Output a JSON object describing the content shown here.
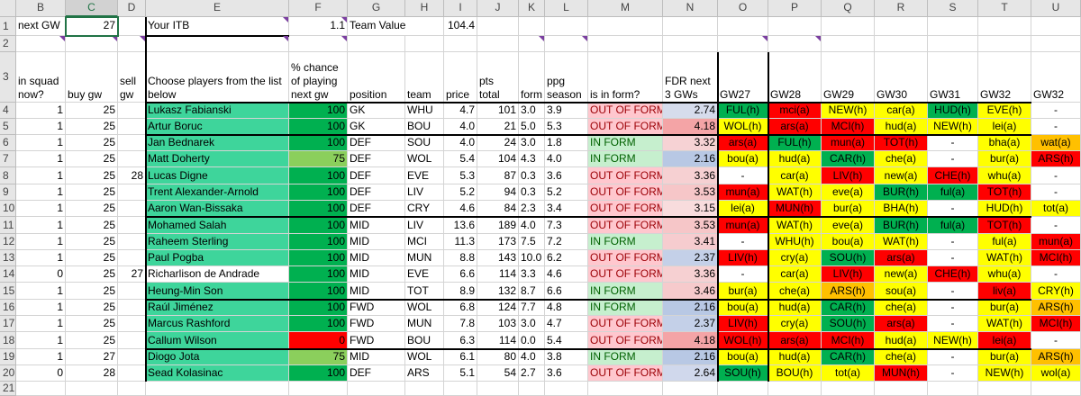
{
  "columns": [
    "B",
    "C",
    "D",
    "E",
    "F",
    "G",
    "H",
    "I",
    "J",
    "K",
    "L",
    "M",
    "N",
    "O",
    "P",
    "Q",
    "R",
    "S",
    "T",
    "U"
  ],
  "row_numbers": [
    "1",
    "2",
    "3",
    "4",
    "5",
    "6",
    "7",
    "8",
    "9",
    "10",
    "11",
    "12",
    "13",
    "14",
    "15",
    "16",
    "17",
    "18",
    "19",
    "20",
    "21"
  ],
  "top": {
    "next_gw_label": "next GW",
    "next_gw_value": "27",
    "itb_label": "Your ITB",
    "itb_value": "1.1",
    "team_value_label": "Team Value",
    "team_value": "104.4"
  },
  "headers": {
    "in_squad": "in squad now?",
    "buy_gw": "buy gw",
    "sell_gw": "sell gw",
    "choose": "Choose players from the list below",
    "pct": "% chance of playing next gw",
    "position": "position",
    "team": "team",
    "price": "price",
    "pts_total": "pts total",
    "form": "form",
    "ppg": "ppg season",
    "is_in_form": "is in form?",
    "fdr": "FDR next 3 GWs",
    "gws": [
      "GW27",
      "GW28",
      "GW29",
      "GW30",
      "GW31",
      "GW32",
      "GW32"
    ]
  },
  "colors": {
    "player_green": "#3ed59b",
    "pct_green": "#00b050",
    "pct_light_green": "#8bcf5c",
    "pct_red": "#ff0000",
    "out_form_bg": "#ffc7ce",
    "out_form_fg": "#9c0006",
    "in_form_bg": "#c6efce",
    "in_form_fg": "#006100",
    "fix_red": "#ff0000",
    "fix_yellow": "#ffff00",
    "fix_orange": "#ffc000",
    "fix_green": "#00b050"
  },
  "rows": [
    {
      "in": "1",
      "buy": "25",
      "sell": "",
      "name": "Lukasz Fabianski",
      "pct": "100",
      "pct_col": "g",
      "pos": "GK",
      "team": "WHU",
      "price": "4.7",
      "pts": "101",
      "form": "3.0",
      "ppg": "3.9",
      "status": "OUT OF FORM",
      "fdr": "2.74",
      "fdr_bg": "#d6dcec",
      "fx": [
        [
          "FUL(h)",
          "g"
        ],
        [
          "mci(a)",
          "r"
        ],
        [
          "NEW(h)",
          "y"
        ],
        [
          "car(a)",
          "y"
        ],
        [
          "HUD(h)",
          "g"
        ],
        [
          "EVE(h)",
          "y"
        ],
        [
          "-",
          ""
        ]
      ]
    },
    {
      "in": "1",
      "buy": "25",
      "sell": "",
      "name": "Artur Boruc",
      "pct": "100",
      "pct_col": "g",
      "pos": "GK",
      "team": "BOU",
      "price": "4.0",
      "pts": "21",
      "form": "5.0",
      "ppg": "5.3",
      "status": "OUT OF FORM",
      "fdr": "4.18",
      "fdr_bg": "#f4a4a6",
      "fx": [
        [
          "WOL(h)",
          "y"
        ],
        [
          "ars(a)",
          "r"
        ],
        [
          "MCI(h)",
          "r"
        ],
        [
          "hud(a)",
          "y"
        ],
        [
          "NEW(h)",
          "y"
        ],
        [
          "lei(a)",
          "y"
        ],
        [
          "-",
          ""
        ]
      ]
    },
    {
      "in": "1",
      "buy": "25",
      "sell": "",
      "name": "Jan Bednarek",
      "pct": "100",
      "pct_col": "g",
      "pos": "DEF",
      "team": "SOU",
      "price": "4.0",
      "pts": "24",
      "form": "3.0",
      "ppg": "1.8",
      "status": "IN FORM",
      "fdr": "3.32",
      "fdr_bg": "#f6d2d4",
      "fx": [
        [
          "ars(a)",
          "r"
        ],
        [
          "FUL(h)",
          "g"
        ],
        [
          "mun(a)",
          "r"
        ],
        [
          "TOT(h)",
          "r"
        ],
        [
          "-",
          ""
        ],
        [
          "bha(a)",
          "y"
        ],
        [
          "wat(a)",
          "o"
        ]
      ]
    },
    {
      "in": "1",
      "buy": "25",
      "sell": "",
      "name": "Matt Doherty",
      "pct": "75",
      "pct_col": "lg",
      "pos": "DEF",
      "team": "WOL",
      "price": "5.4",
      "pts": "104",
      "form": "4.3",
      "ppg": "4.0",
      "status": "IN FORM",
      "fdr": "2.16",
      "fdr_bg": "#b8c8e4",
      "fx": [
        [
          "bou(a)",
          "y"
        ],
        [
          "hud(a)",
          "y"
        ],
        [
          "CAR(h)",
          "g"
        ],
        [
          "che(a)",
          "y"
        ],
        [
          "-",
          ""
        ],
        [
          "bur(a)",
          "y"
        ],
        [
          "ARS(h)",
          "r"
        ]
      ]
    },
    {
      "in": "1",
      "buy": "25",
      "sell": "28",
      "name": "Lucas Digne",
      "pct": "100",
      "pct_col": "g",
      "pos": "DEF",
      "team": "EVE",
      "price": "5.3",
      "pts": "87",
      "form": "0.3",
      "ppg": "3.6",
      "status": "OUT OF FORM",
      "fdr": "3.36",
      "fdr_bg": "#f6d0d2",
      "fx": [
        [
          "-",
          ""
        ],
        [
          "car(a)",
          "y"
        ],
        [
          "LIV(h)",
          "r"
        ],
        [
          "new(a)",
          "y"
        ],
        [
          "CHE(h)",
          "r"
        ],
        [
          "whu(a)",
          "y"
        ],
        [
          "-",
          ""
        ]
      ]
    },
    {
      "in": "1",
      "buy": "25",
      "sell": "",
      "name": "Trent Alexander-Arnold",
      "pct": "100",
      "pct_col": "g",
      "pos": "DEF",
      "team": "LIV",
      "price": "5.2",
      "pts": "94",
      "form": "0.3",
      "ppg": "5.2",
      "status": "OUT OF FORM",
      "fdr": "3.53",
      "fdr_bg": "#f6c6c8",
      "fx": [
        [
          "mun(a)",
          "r"
        ],
        [
          "WAT(h)",
          "y"
        ],
        [
          "eve(a)",
          "y"
        ],
        [
          "BUR(h)",
          "g"
        ],
        [
          "ful(a)",
          "g"
        ],
        [
          "TOT(h)",
          "r"
        ],
        [
          "-",
          ""
        ]
      ]
    },
    {
      "in": "1",
      "buy": "25",
      "sell": "",
      "name": "Aaron Wan-Bissaka",
      "pct": "100",
      "pct_col": "g",
      "pos": "DEF",
      "team": "CRY",
      "price": "4.6",
      "pts": "84",
      "form": "2.3",
      "ppg": "3.4",
      "status": "OUT OF FORM",
      "fdr": "3.15",
      "fdr_bg": "#f8dcdd",
      "fx": [
        [
          "lei(a)",
          "y"
        ],
        [
          "MUN(h)",
          "r"
        ],
        [
          "bur(a)",
          "y"
        ],
        [
          "BHA(h)",
          "y"
        ],
        [
          "-",
          ""
        ],
        [
          "HUD(h)",
          "y"
        ],
        [
          "tot(a)",
          "y"
        ]
      ]
    },
    {
      "in": "1",
      "buy": "25",
      "sell": "",
      "name": "Mohamed Salah",
      "pct": "100",
      "pct_col": "g",
      "pos": "MID",
      "team": "LIV",
      "price": "13.6",
      "pts": "189",
      "form": "4.0",
      "ppg": "7.3",
      "status": "OUT OF FORM",
      "fdr": "3.53",
      "fdr_bg": "#f6c6c8",
      "fx": [
        [
          "mun(a)",
          "r"
        ],
        [
          "WAT(h)",
          "y"
        ],
        [
          "eve(a)",
          "y"
        ],
        [
          "BUR(h)",
          "g"
        ],
        [
          "ful(a)",
          "g"
        ],
        [
          "TOT(h)",
          "r"
        ],
        [
          "-",
          ""
        ]
      ]
    },
    {
      "in": "1",
      "buy": "25",
      "sell": "",
      "name": "Raheem Sterling",
      "pct": "100",
      "pct_col": "g",
      "pos": "MID",
      "team": "MCI",
      "price": "11.3",
      "pts": "173",
      "form": "7.5",
      "ppg": "7.2",
      "status": "IN FORM",
      "fdr": "3.41",
      "fdr_bg": "#f6cccf",
      "fx": [
        [
          "-",
          ""
        ],
        [
          "WHU(h)",
          "y"
        ],
        [
          "bou(a)",
          "y"
        ],
        [
          "WAT(h)",
          "y"
        ],
        [
          "-",
          ""
        ],
        [
          "ful(a)",
          "y"
        ],
        [
          "mun(a)",
          "r"
        ]
      ]
    },
    {
      "in": "1",
      "buy": "25",
      "sell": "",
      "name": "Paul Pogba",
      "pct": "100",
      "pct_col": "g",
      "pos": "MID",
      "team": "MUN",
      "price": "8.8",
      "pts": "143",
      "form": "10.0",
      "ppg": "6.2",
      "status": "OUT OF FORM",
      "fdr": "2.37",
      "fdr_bg": "#c4d0e8",
      "fx": [
        [
          "LIV(h)",
          "r"
        ],
        [
          "cry(a)",
          "y"
        ],
        [
          "SOU(h)",
          "g"
        ],
        [
          "ars(a)",
          "r"
        ],
        [
          "-",
          ""
        ],
        [
          "WAT(h)",
          "y"
        ],
        [
          "MCI(h)",
          "r"
        ]
      ]
    },
    {
      "in": "0",
      "buy": "25",
      "sell": "27",
      "name": "Richarlison de Andrade",
      "pct": "100",
      "pct_col": "g",
      "pos": "MID",
      "team": "EVE",
      "price": "6.6",
      "pts": "114",
      "form": "3.3",
      "ppg": "4.6",
      "status": "OUT OF FORM",
      "fdr": "3.36",
      "fdr_bg": "#f6d0d2",
      "name_white": true,
      "fx": [
        [
          "-",
          ""
        ],
        [
          "car(a)",
          "y"
        ],
        [
          "LIV(h)",
          "r"
        ],
        [
          "new(a)",
          "y"
        ],
        [
          "CHE(h)",
          "r"
        ],
        [
          "whu(a)",
          "y"
        ],
        [
          "-",
          ""
        ]
      ]
    },
    {
      "in": "1",
      "buy": "25",
      "sell": "",
      "name": "Heung-Min Son",
      "pct": "100",
      "pct_col": "g",
      "pos": "MID",
      "team": "TOT",
      "price": "8.9",
      "pts": "132",
      "form": "8.7",
      "ppg": "6.6",
      "status": "IN FORM",
      "fdr": "3.46",
      "fdr_bg": "#f6cacc",
      "fx": [
        [
          "bur(a)",
          "y"
        ],
        [
          "che(a)",
          "y"
        ],
        [
          "ARS(h)",
          "o"
        ],
        [
          "sou(a)",
          "y"
        ],
        [
          "-",
          ""
        ],
        [
          "liv(a)",
          "r"
        ],
        [
          "CRY(h)",
          "y"
        ]
      ]
    },
    {
      "in": "1",
      "buy": "25",
      "sell": "",
      "name": "Raúl Jiménez",
      "pct": "100",
      "pct_col": "g",
      "pos": "FWD",
      "team": "WOL",
      "price": "6.8",
      "pts": "124",
      "form": "7.7",
      "ppg": "4.8",
      "status": "IN FORM",
      "fdr": "2.16",
      "fdr_bg": "#b8c8e4",
      "fx": [
        [
          "bou(a)",
          "y"
        ],
        [
          "hud(a)",
          "y"
        ],
        [
          "CAR(h)",
          "g"
        ],
        [
          "che(a)",
          "y"
        ],
        [
          "-",
          ""
        ],
        [
          "bur(a)",
          "y"
        ],
        [
          "ARS(h)",
          "o"
        ]
      ]
    },
    {
      "in": "1",
      "buy": "25",
      "sell": "",
      "name": "Marcus Rashford",
      "pct": "100",
      "pct_col": "g",
      "pos": "FWD",
      "team": "MUN",
      "price": "7.8",
      "pts": "103",
      "form": "3.0",
      "ppg": "4.7",
      "status": "OUT OF FORM",
      "fdr": "2.37",
      "fdr_bg": "#c4d0e8",
      "fx": [
        [
          "LIV(h)",
          "r"
        ],
        [
          "cry(a)",
          "y"
        ],
        [
          "SOU(h)",
          "g"
        ],
        [
          "ars(a)",
          "r"
        ],
        [
          "-",
          ""
        ],
        [
          "WAT(h)",
          "y"
        ],
        [
          "MCI(h)",
          "r"
        ]
      ]
    },
    {
      "in": "1",
      "buy": "25",
      "sell": "",
      "name": "Callum Wilson",
      "pct": "0",
      "pct_col": "r",
      "pos": "FWD",
      "team": "BOU",
      "price": "6.3",
      "pts": "114",
      "form": "0.0",
      "ppg": "5.4",
      "status": "OUT OF FORM",
      "fdr": "4.18",
      "fdr_bg": "#f4a4a6",
      "fx": [
        [
          "WOL(h)",
          "r"
        ],
        [
          "ars(a)",
          "r"
        ],
        [
          "MCI(h)",
          "r"
        ],
        [
          "hud(a)",
          "y"
        ],
        [
          "NEW(h)",
          "y"
        ],
        [
          "lei(a)",
          "r"
        ],
        [
          "-",
          ""
        ]
      ]
    },
    {
      "in": "1",
      "buy": "27",
      "sell": "",
      "name": "Diogo Jota",
      "pct": "75",
      "pct_col": "lg",
      "pos": "MID",
      "team": "WOL",
      "price": "6.1",
      "pts": "80",
      "form": "4.0",
      "ppg": "3.8",
      "status": "IN FORM",
      "fdr": "2.16",
      "fdr_bg": "#b8c8e4",
      "fx": [
        [
          "bou(a)",
          "y"
        ],
        [
          "hud(a)",
          "y"
        ],
        [
          "CAR(h)",
          "g"
        ],
        [
          "che(a)",
          "y"
        ],
        [
          "-",
          ""
        ],
        [
          "bur(a)",
          "y"
        ],
        [
          "ARS(h)",
          "o"
        ]
      ]
    },
    {
      "in": "0",
      "buy": "28",
      "sell": "",
      "name": "Sead Kolasinac",
      "pct": "100",
      "pct_col": "g",
      "pos": "DEF",
      "team": "ARS",
      "price": "5.1",
      "pts": "54",
      "form": "2.7",
      "ppg": "3.6",
      "status": "OUT OF FORM",
      "fdr": "2.64",
      "fdr_bg": "#d0d8ec",
      "fx": [
        [
          "SOU(h)",
          "g"
        ],
        [
          "BOU(h)",
          "y"
        ],
        [
          "tot(a)",
          "y"
        ],
        [
          "MUN(h)",
          "r"
        ],
        [
          "-",
          ""
        ],
        [
          "NEW(h)",
          "y"
        ],
        [
          "wol(a)",
          "y"
        ]
      ]
    }
  ]
}
